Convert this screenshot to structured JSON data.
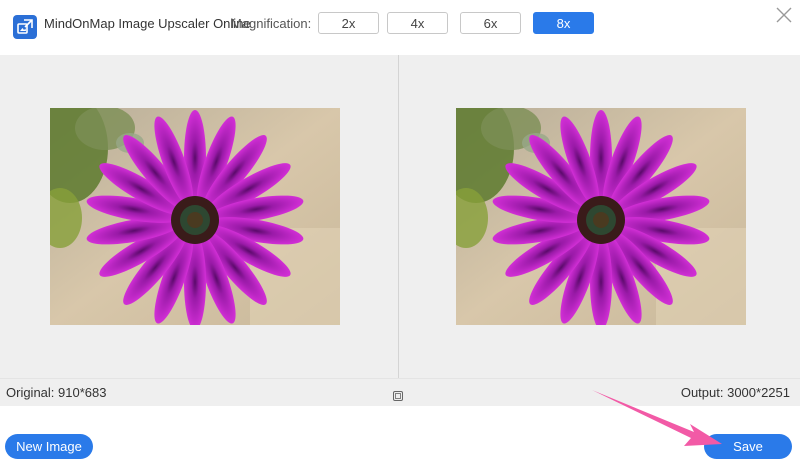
{
  "app": {
    "title": "MindOnMap Image Upscaler Online"
  },
  "magnification": {
    "label": "Magnification:",
    "options": [
      "2x",
      "4x",
      "6x",
      "8x"
    ],
    "selected": "8x"
  },
  "preview": {
    "original_label": "Original: 910*683",
    "output_label": "Output: 3000*2251"
  },
  "footer": {
    "new_image_label": "New Image",
    "save_label": "Save"
  },
  "colors": {
    "accent": "#2a7ae9",
    "arrow": "#f25aa6"
  },
  "icons": {
    "logo": "upscale-logo-icon",
    "close": "close-icon",
    "compare": "compare-icon"
  }
}
